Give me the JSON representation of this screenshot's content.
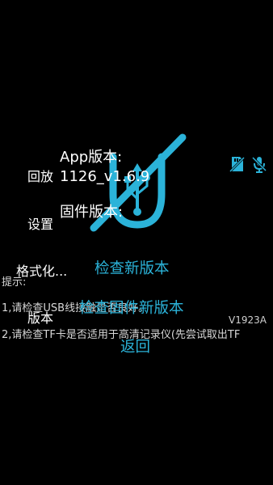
{
  "left_menu": {
    "playback": "回放",
    "settings": "设置",
    "format": "格式化...",
    "version": "版本"
  },
  "info": {
    "app_version_label": "App版本:",
    "app_version_value": "1126_v1.6.9",
    "firmware_version_label": "固件版本:"
  },
  "actions": {
    "check_new_version": "检查新版本",
    "check_firmware_new_version": "检查固件新版本",
    "back": "返回"
  },
  "hints": {
    "title": "提示:",
    "line1": "1,请检查USB线接触是否良好。",
    "line2": "2,请检查TF卡是否适用于高清记录仪(先尝试取出TF"
  },
  "device_version": "V1923A",
  "colors": {
    "accent": "#2bb3d9",
    "background": "#000000",
    "text": "#ffffff"
  },
  "icons": {
    "emblem": "usb-disconnected-icon",
    "status_1": "sd-card-off-icon",
    "status_2": "microphone-off-icon"
  }
}
